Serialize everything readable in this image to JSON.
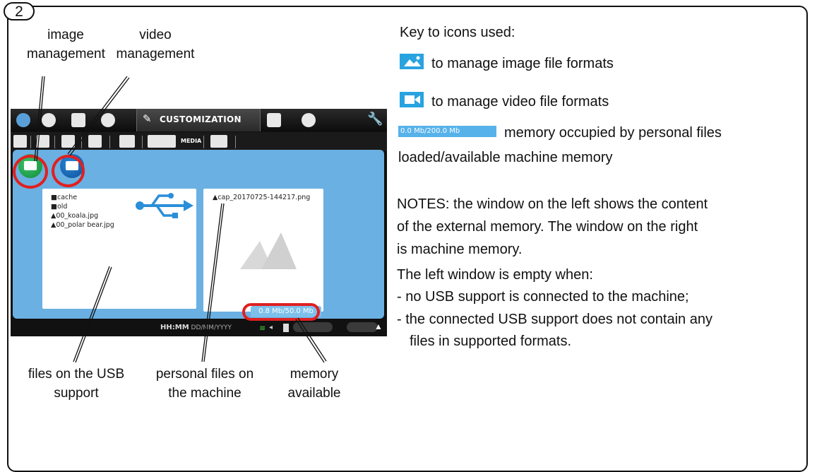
{
  "step_number": "2",
  "callouts": {
    "image_management": [
      "image",
      "management"
    ],
    "video_management": [
      "video",
      "management"
    ],
    "files_on_usb": [
      "files on the USB",
      "support"
    ],
    "personal_files": [
      "personal files on",
      "the machine"
    ],
    "memory_available": [
      "memory",
      "available"
    ]
  },
  "screen": {
    "top_tab_label": "CUSTOMIZATION",
    "sub_tab_label": "MEDIA",
    "usb_files": [
      "cache",
      "old",
      "00_koala.jpg",
      "00_polar bear.jpg"
    ],
    "machine_files": [
      "cap_20170725-144217.png"
    ],
    "memory_readout": "0.8 Mb/50.0 Mb",
    "status_time": "HH:MM",
    "status_date": "DD/MM/YYYY"
  },
  "key": {
    "heading": "Key to icons used:",
    "image_icon_text": "to manage image file formats",
    "video_icon_text": "to manage video file formats",
    "memory_sample": "0.0 Mb/200.0 Mb",
    "memory_text_1": "memory occupied by personal files",
    "memory_text_2": "loaded/available machine memory"
  },
  "notes": {
    "line1": "NOTES: the window on the left shows the content",
    "line2": "of the external memory. The window on the right",
    "line3": "is machine memory.",
    "empty_heading": "The left window is empty when:",
    "bullet1": "- no USB support is connected to the machine;",
    "bullet2a": "- the connected USB support does not contain any",
    "bullet2b": "files in supported formats."
  },
  "colors": {
    "panel_blue": "#6ab0e2",
    "highlight_red": "#e02020",
    "icon_blue": "#28a3e0",
    "image_button_green": "#1ea24a"
  }
}
